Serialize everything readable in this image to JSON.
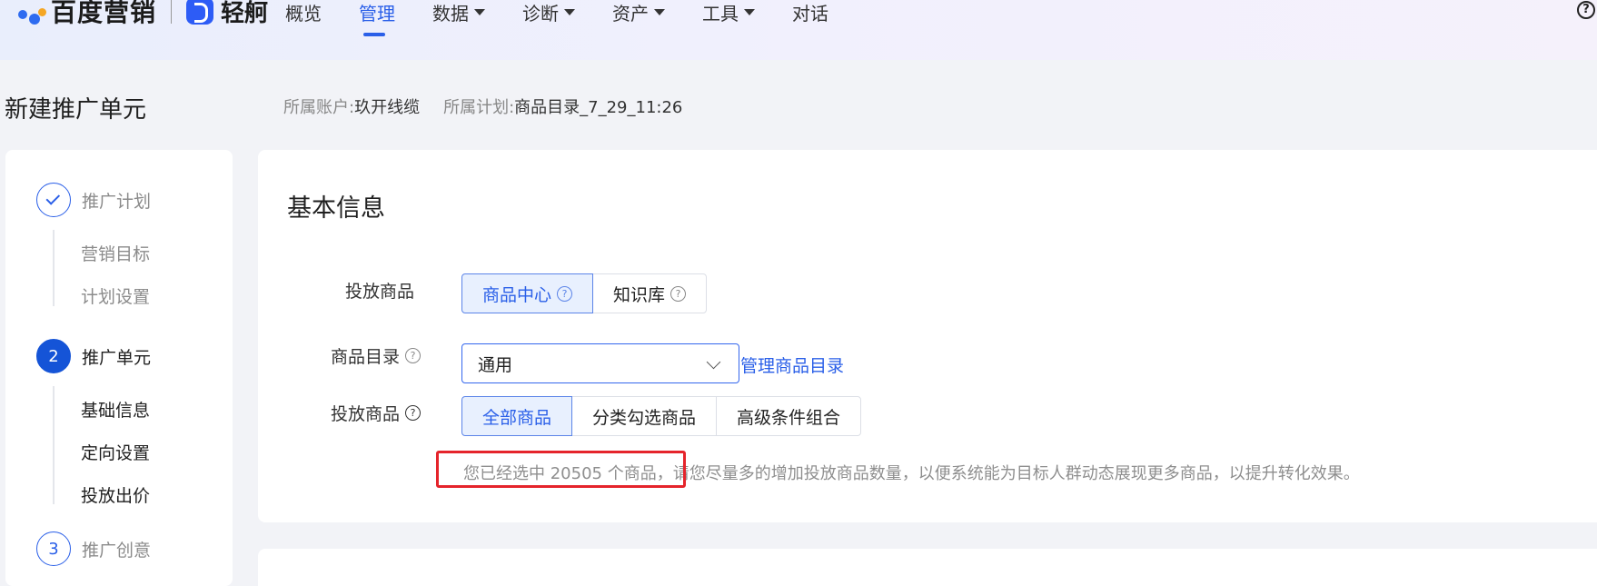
{
  "brand": {
    "primary": "百度营销",
    "secondary": "轻舸"
  },
  "nav": {
    "items": [
      {
        "label": "概览",
        "dropdown": false
      },
      {
        "label": "管理",
        "dropdown": false,
        "active": true
      },
      {
        "label": "数据",
        "dropdown": true
      },
      {
        "label": "诊断",
        "dropdown": true
      },
      {
        "label": "资产",
        "dropdown": true
      },
      {
        "label": "工具",
        "dropdown": true
      },
      {
        "label": "对话",
        "dropdown": false
      }
    ],
    "help_glyph": "?"
  },
  "header": {
    "title": "新建推广单元",
    "account_key": "所属账户:",
    "account_value": "玖开线缆",
    "plan_key": "所属计划:",
    "plan_value": "商品目录_7_29_11:26"
  },
  "steps": [
    {
      "number": "",
      "label": "推广计划",
      "state": "done",
      "subs": [
        "营销目标",
        "计划设置"
      ]
    },
    {
      "number": "2",
      "label": "推广单元",
      "state": "current",
      "subs": [
        "基础信息",
        "定向设置",
        "投放出价"
      ]
    },
    {
      "number": "3",
      "label": "推广创意",
      "state": "todo",
      "subs": []
    }
  ],
  "form": {
    "section_title": "基本信息",
    "delivery_label": "投放商品",
    "delivery_options": [
      "商品中心",
      "知识库"
    ],
    "delivery_selected": "商品中心",
    "catalog_label": "商品目录",
    "catalog_value": "通用",
    "catalog_link": "管理商品目录",
    "scope_label": "投放商品",
    "scope_options": [
      "全部商品",
      "分类勾选商品",
      "高级条件组合"
    ],
    "scope_selected": "全部商品",
    "hint_text": "您已经选中 20505 个商品，请您尽量多的增加投放商品数量，以便系统能为目标人群动态展现更多商品，以提升转化效果。"
  },
  "colors": {
    "accent": "#2a5fe8",
    "highlight_box": "#e5242b"
  }
}
